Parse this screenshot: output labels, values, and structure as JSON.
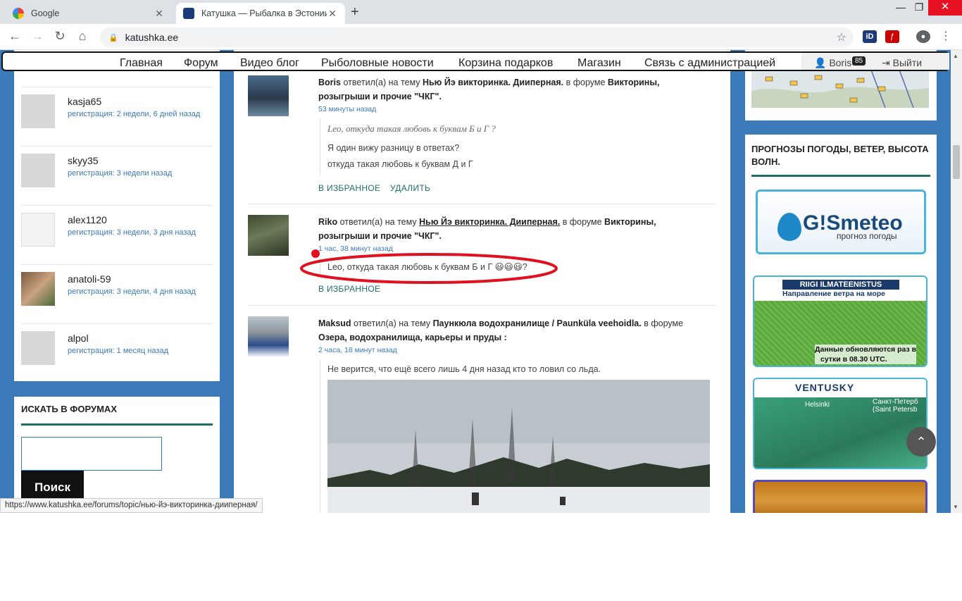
{
  "browser": {
    "tabs": [
      {
        "title": "Google"
      },
      {
        "title": "Катушка — Рыбалка в Эстонии"
      }
    ],
    "url": "katushka.ee",
    "status_url": "https://www.katushka.ee/forums/topic/нью-йэ-викторинка-дииперная/"
  },
  "menu": {
    "items": [
      "Главная",
      "Форум",
      "Видео блог",
      "Рыболовные новости",
      "Корзина подарков",
      "Магазин",
      "Связь с администрацией"
    ],
    "user": "Boris",
    "badge": "85",
    "logout": "Выйти"
  },
  "members": [
    {
      "name": "kasja65",
      "reg": "регистрация: 2 недели, 6 дней назад"
    },
    {
      "name": "skyy35",
      "reg": "регистрация: 3 недели назад"
    },
    {
      "name": "alex1120",
      "reg": "регистрация: 3 недели, 3 дня назад"
    },
    {
      "name": "anatoli-59",
      "reg": "регистрация: 3 недели, 4 дня назад"
    },
    {
      "name": "alpol",
      "reg": "регистрация: 1 месяц назад"
    }
  ],
  "search": {
    "title": "ИСКАТЬ В ФОРУМАХ",
    "button": "Поиск"
  },
  "posts": [
    {
      "user": "Boris",
      "verb": "ответил(а) на тему",
      "topic": "Нью Йэ викторинка. Дииперная.",
      "in_forum": "в форуме",
      "forum_line1": "Викторины,",
      "forum_line2": "розыгрыши и прочие \"ЧКГ\".",
      "time": "53 минуты назад",
      "quote_italic": "Leo, откуда такая любовь к буквам Б и Г ?",
      "line2": "Я один вижу разницу в ответах?",
      "line3": "откуда такая любовь к буквам Д и Г",
      "fav": "В ИЗБРАННОЕ",
      "del": "УДАЛИТЬ"
    },
    {
      "user": "Riko",
      "verb": "ответил(а) на тему",
      "topic": "Нью Йэ викторинка. Дииперная.",
      "in_forum": "в форуме",
      "forum_line1": "Викторины,",
      "forum_line2": "розыгрыши и прочие \"ЧКГ\".",
      "time": "1 час, 38 минут назад",
      "text": "Leo, откуда такая любовь к буквам Б и Г 😃😃😃?",
      "fav": "В ИЗБРАННОЕ"
    },
    {
      "user": "Maksud",
      "verb": "ответил(а) на тему",
      "topic": "Паункюла водохранилище / Paunküla veehoidla.",
      "in_forum": "в форуме",
      "forum_line2": "Озера, водохранилища, карьеры и пруды :",
      "time": "2 часа, 18 минут назад",
      "text": "Не верится, что ещё всего лишь 4 дня назад кто то ловил со льда."
    }
  ],
  "right": {
    "weather_title": "ПРОГНОЗЫ ПОГОДЫ, ВЕТЕР, ВЫСОТА ВОЛН.",
    "gismeteo": "G!Smeteo",
    "gismeteo_sub": "прогноз погоды",
    "riigi": "RIIGI ILMATEENISTUS",
    "riigi_sub": "Направление ветра на море",
    "riigi_note1": "Данные обновляются раз в",
    "riigi_note2": "сутки в 08.30 UTC.",
    "ventusky": "VENTUSKY",
    "helsinki": "Helsinki",
    "spb1": "Санкт-Петерб",
    "spb2": "(Saint Petersb"
  },
  "colors": {
    "accent": "#3a7ab8",
    "teal": "#1f6e6a",
    "annotation": "#e0101e"
  }
}
